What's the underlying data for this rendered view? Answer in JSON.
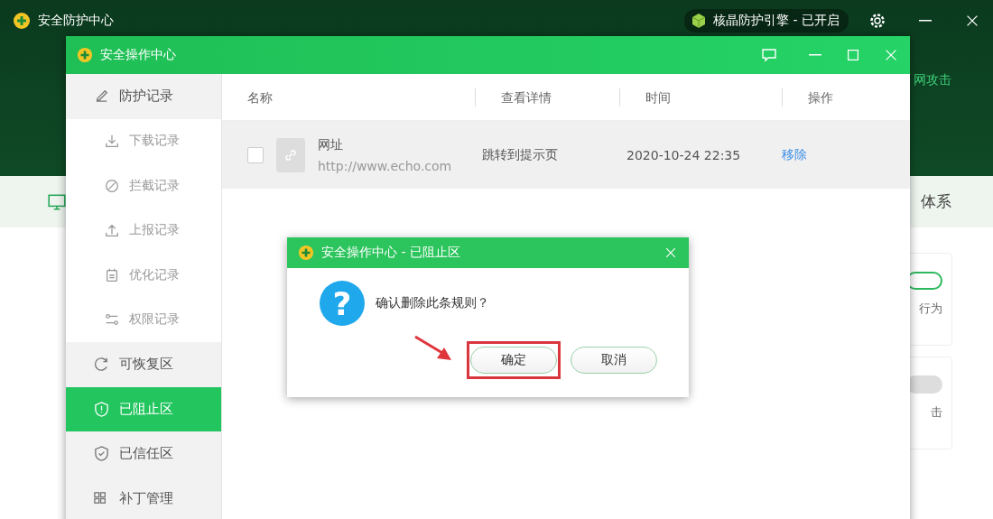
{
  "app": {
    "title": "安全防护中心",
    "engine_badge": "核晶防护引擎 - 已开启",
    "banner_text": "网攻击",
    "tab_text": "体系",
    "cards": [
      {
        "label": "行为",
        "on": true
      },
      {
        "label": "击",
        "on": false
      }
    ]
  },
  "window": {
    "title": "安全操作中心"
  },
  "sidebar": {
    "items": [
      {
        "label": "防护记录",
        "selected": false,
        "children": [
          {
            "label": "下载记录",
            "selected": false
          },
          {
            "label": "拦截记录",
            "selected": false
          },
          {
            "label": "上报记录",
            "selected": false
          },
          {
            "label": "优化记录",
            "selected": false
          },
          {
            "label": "权限记录",
            "selected": false
          }
        ]
      },
      {
        "label": "可恢复区",
        "selected": false
      },
      {
        "label": "已阻止区",
        "selected": true
      },
      {
        "label": "已信任区",
        "selected": false
      },
      {
        "label": "补丁管理",
        "selected": false
      }
    ]
  },
  "table": {
    "columns": [
      "名称",
      "查看详情",
      "时间",
      "操作"
    ],
    "rows": [
      {
        "checked": false,
        "name": "网址",
        "url": "http://www.echo.com",
        "detail": "跳转到提示页",
        "time": "2020-10-24 22:35",
        "action": "移除"
      }
    ]
  },
  "dialog": {
    "title": "安全操作中心 - 已阻止区",
    "icon": "?",
    "message": "确认删除此条规则？",
    "buttons": [
      {
        "label": "确定",
        "highlighted": true
      },
      {
        "label": "取消",
        "highlighted": false
      }
    ]
  }
}
